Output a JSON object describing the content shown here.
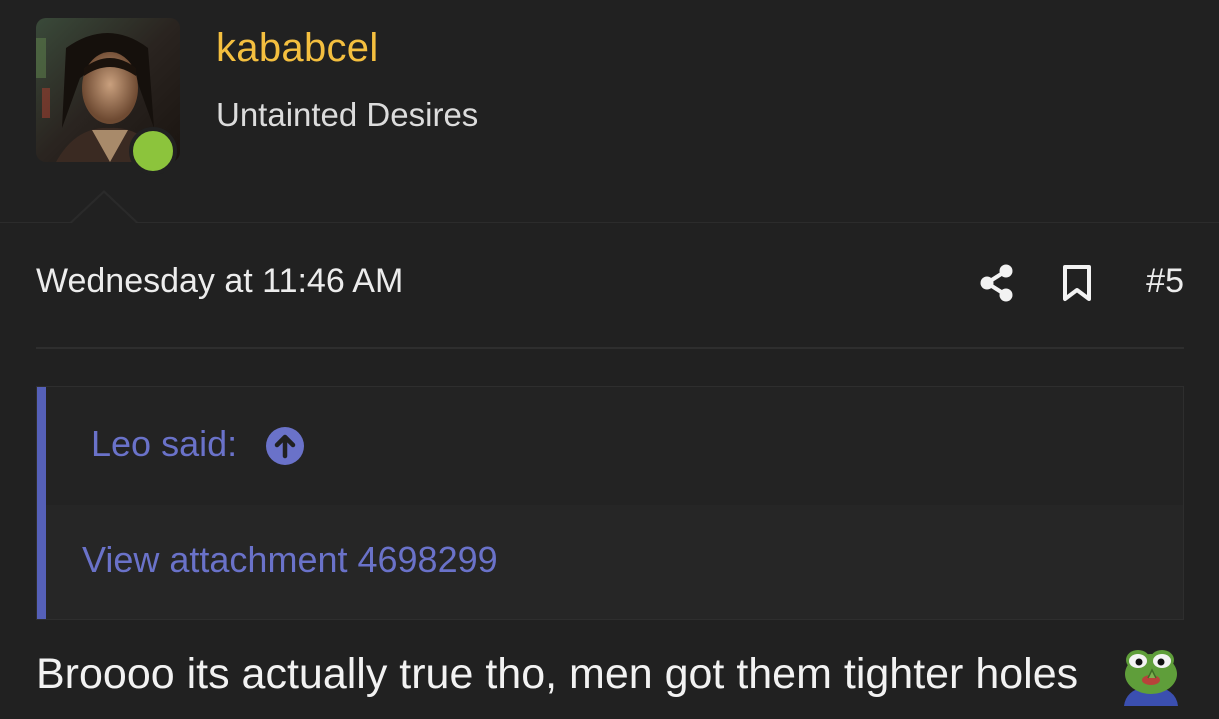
{
  "user": {
    "username": "kababcel",
    "title": "Untainted Desires",
    "online": true,
    "colors": {
      "username": "#f4bf3f",
      "online_dot": "#8cc43c"
    }
  },
  "post": {
    "date": "Wednesday at 11:46 AM",
    "number": "#5",
    "actions": {
      "share_icon": "share-icon",
      "bookmark_icon": "bookmark-icon"
    }
  },
  "quote": {
    "author_label": "Leo said:",
    "jump_icon": "arrow-up-circle-icon",
    "attachment_text": "View attachment 4698299",
    "accent_color": "#5560b8",
    "link_color": "#6a72c9"
  },
  "message": {
    "text": "Broooo its actually true tho, men got them tighter holes",
    "emoji": "pepe-frog-emoji"
  }
}
